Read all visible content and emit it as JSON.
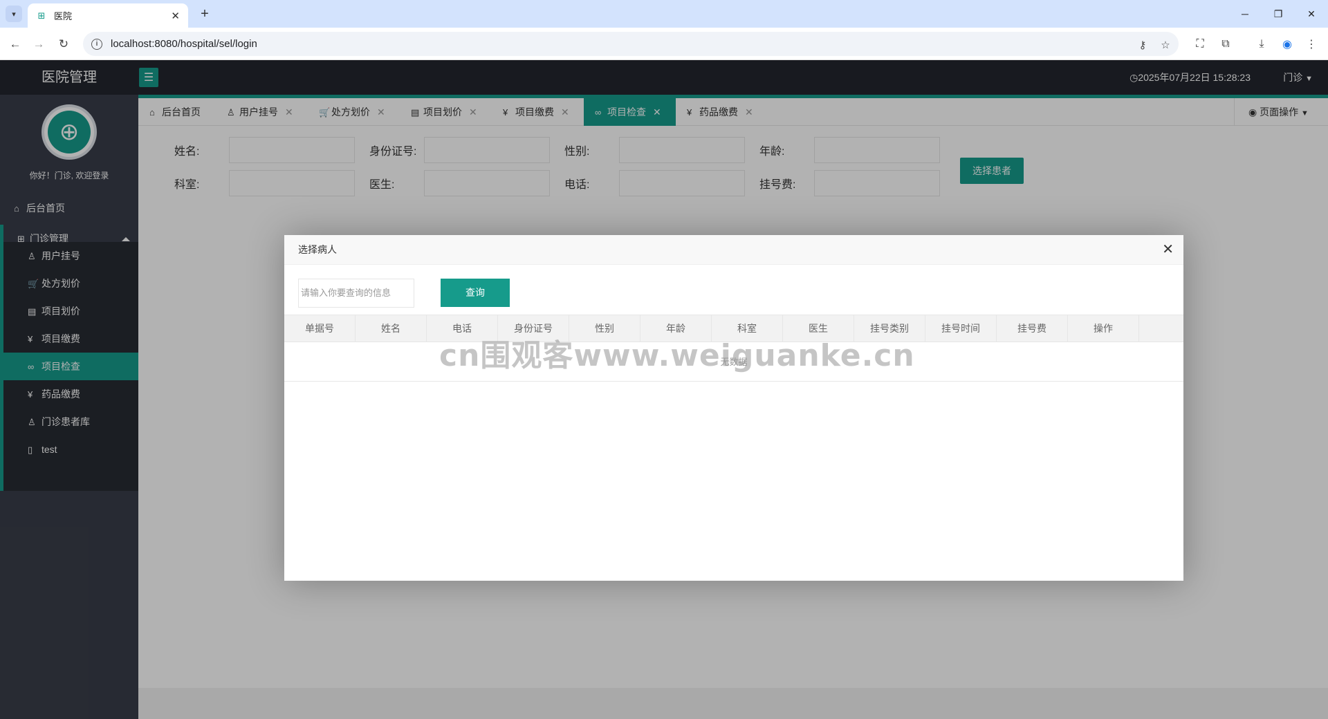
{
  "browser": {
    "tab_title": "医院",
    "url": "localhost:8080/hospital/sel/login"
  },
  "header": {
    "logo": "医院管理",
    "clock": "2025年07月22日 15:28:23",
    "user": "门诊"
  },
  "sidebar": {
    "welcome": "你好！门诊, 欢迎登录",
    "home": "后台首页",
    "group": "门诊管理",
    "items": [
      {
        "label": "用户挂号",
        "icon": "user-icon"
      },
      {
        "label": "处方划价",
        "icon": "cart-icon"
      },
      {
        "label": "项目划价",
        "icon": "file-icon"
      },
      {
        "label": "项目缴费",
        "icon": "yen-icon"
      },
      {
        "label": "项目检查",
        "icon": "link-icon"
      },
      {
        "label": "药品缴费",
        "icon": "yen-icon"
      },
      {
        "label": "门诊患者库",
        "icon": "person-icon"
      },
      {
        "label": "test",
        "icon": "tablet-icon"
      }
    ],
    "active_item": "项目检查"
  },
  "tabs": {
    "items": [
      "后台首页",
      "用户挂号",
      "处方划价",
      "项目划价",
      "项目缴费",
      "项目检查",
      "药品缴费"
    ],
    "active": "项目检查",
    "page_ops": "页面操作"
  },
  "form": {
    "labels": [
      "姓名:",
      "身份证号:",
      "性别:",
      "年龄:",
      "科室:",
      "医生:",
      "电话:",
      "挂号费:"
    ],
    "select_button": "选择患者"
  },
  "modal": {
    "title": "选择病人",
    "search_placeholder": "请输入你要查询的信息",
    "search_button": "查询",
    "columns": [
      "单据号",
      "姓名",
      "电话",
      "身份证号",
      "性别",
      "年龄",
      "科室",
      "医生",
      "挂号类别",
      "挂号时间",
      "挂号费",
      "操作"
    ],
    "empty_text": "无数据"
  },
  "watermark": "cn围观客www.weiguanke.cn",
  "colors": {
    "accent": "#169b8b",
    "header_bg": "#23262e",
    "sidebar_bg": "#393d49",
    "submenu_bg": "#282b33"
  }
}
